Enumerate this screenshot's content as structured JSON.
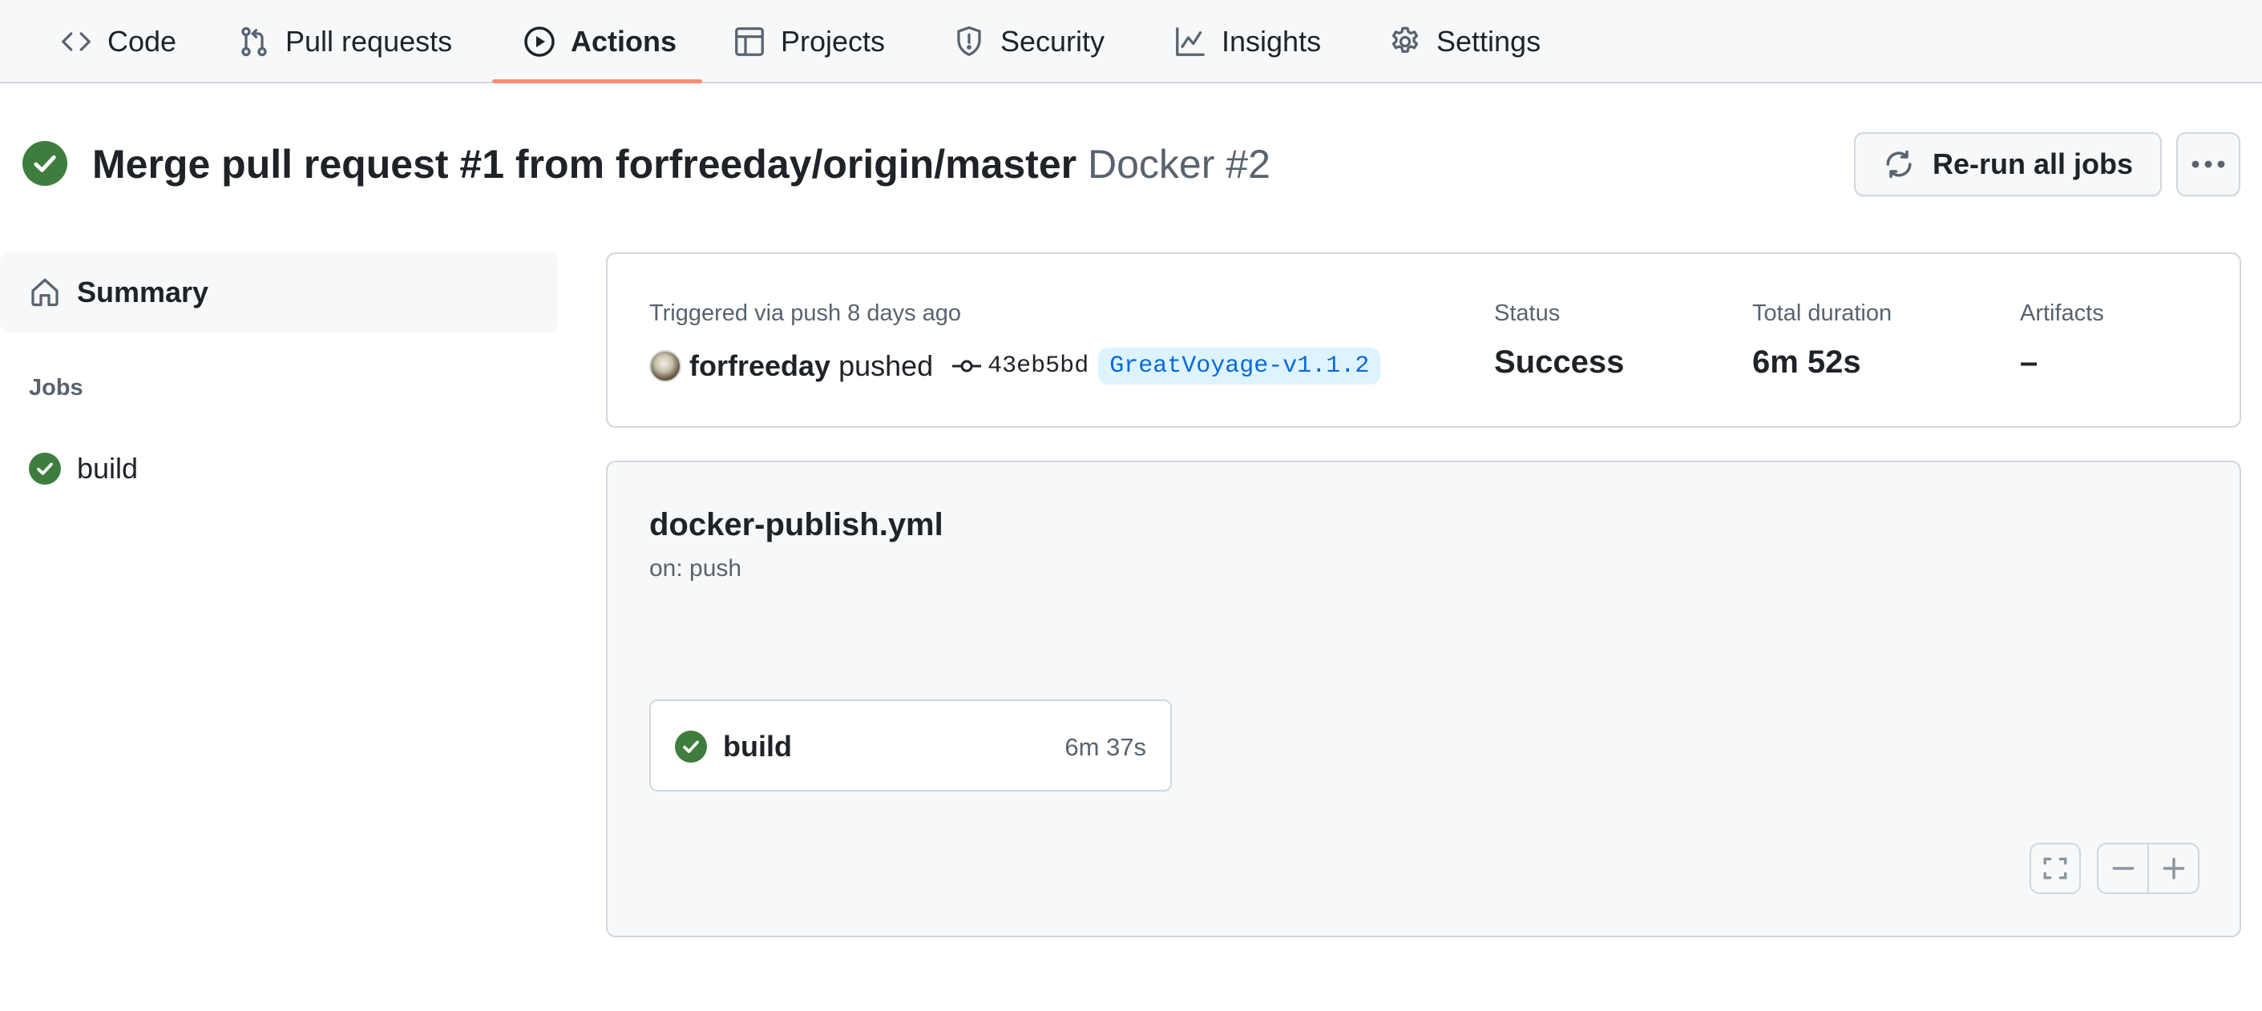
{
  "nav": {
    "tabs": [
      {
        "label": "Code",
        "icon": "code-icon",
        "active": false
      },
      {
        "label": "Pull requests",
        "icon": "git-pull-request-icon",
        "active": false
      },
      {
        "label": "Actions",
        "icon": "play-icon",
        "active": true
      },
      {
        "label": "Projects",
        "icon": "table-icon",
        "active": false
      },
      {
        "label": "Security",
        "icon": "shield-icon",
        "active": false
      },
      {
        "label": "Insights",
        "icon": "graph-icon",
        "active": false
      },
      {
        "label": "Settings",
        "icon": "gear-icon",
        "active": false
      }
    ],
    "active_color": "#fd8c73"
  },
  "run": {
    "status": "success",
    "title": "Merge pull request #1 from forfreeday/origin/master",
    "workflow_run": "Docker #2",
    "rerun_label": "Re-run all jobs",
    "more_label": "More options"
  },
  "sidebar": {
    "summary_label": "Summary",
    "jobs_heading": "Jobs",
    "jobs": [
      {
        "name": "build",
        "status": "success"
      }
    ]
  },
  "summary": {
    "trigger_text": "Triggered via push 8 days ago",
    "actor": "forfreeday",
    "action": "pushed",
    "commit_sha": "43eb5bd",
    "branch": "GreatVoyage-v1.1.2",
    "status_label": "Status",
    "status_value": "Success",
    "duration_label": "Total duration",
    "duration_value": "6m 52s",
    "artifacts_label": "Artifacts",
    "artifacts_value": "–"
  },
  "graph": {
    "workflow_file": "docker-publish.yml",
    "trigger": "on: push",
    "jobs": [
      {
        "name": "build",
        "duration": "6m 37s",
        "status": "success"
      }
    ]
  },
  "colors": {
    "success": "#1a7f37",
    "success_icon_bg": "#3f7d3f",
    "link": "#0969da",
    "muted": "#59636e"
  }
}
